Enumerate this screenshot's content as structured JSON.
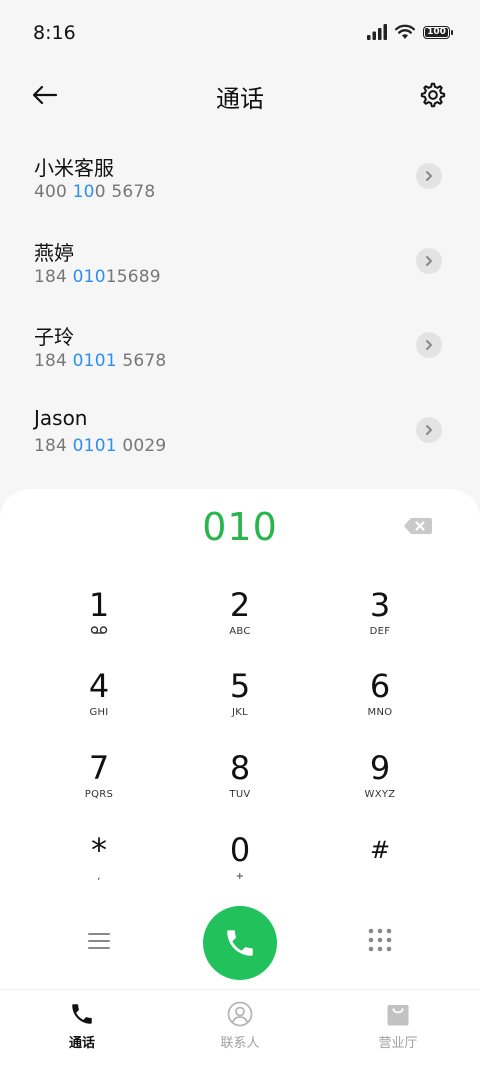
{
  "status_bar": {
    "time": "8:16",
    "battery_level": "100"
  },
  "header": {
    "title": "通话"
  },
  "contacts": [
    {
      "name": "小米客服",
      "number_parts": [
        "400 ",
        "10",
        "0 5678"
      ]
    },
    {
      "name": "燕婷",
      "number_parts": [
        "184 ",
        "010",
        "15689"
      ]
    },
    {
      "name": "子玲",
      "number_parts": [
        "184 ",
        "0101",
        " 5678"
      ]
    },
    {
      "name": "Jason",
      "number_parts": [
        "184 ",
        "0101",
        " 0029"
      ]
    }
  ],
  "colors": {
    "highlight": "#2d8ff0",
    "dialed": "#28b54c",
    "call_button": "#21c15b"
  },
  "dialpad": {
    "dialed_number": "010",
    "keys": [
      {
        "digit": "1",
        "letters": ""
      },
      {
        "digit": "2",
        "letters": "ABC"
      },
      {
        "digit": "3",
        "letters": "DEF"
      },
      {
        "digit": "4",
        "letters": "GHI"
      },
      {
        "digit": "5",
        "letters": "JKL"
      },
      {
        "digit": "6",
        "letters": "MNO"
      },
      {
        "digit": "7",
        "letters": "PQRS"
      },
      {
        "digit": "8",
        "letters": "TUV"
      },
      {
        "digit": "9",
        "letters": "WXYZ"
      },
      {
        "digit": "*",
        "letters": ","
      },
      {
        "digit": "0",
        "letters": "+"
      },
      {
        "digit": "#",
        "letters": ""
      }
    ]
  },
  "bottom_nav": [
    {
      "label": "通话",
      "icon": "phone-icon",
      "active": true
    },
    {
      "label": "联系人",
      "icon": "contacts-icon",
      "active": false
    },
    {
      "label": "营业厅",
      "icon": "store-bag-icon",
      "active": false
    }
  ]
}
